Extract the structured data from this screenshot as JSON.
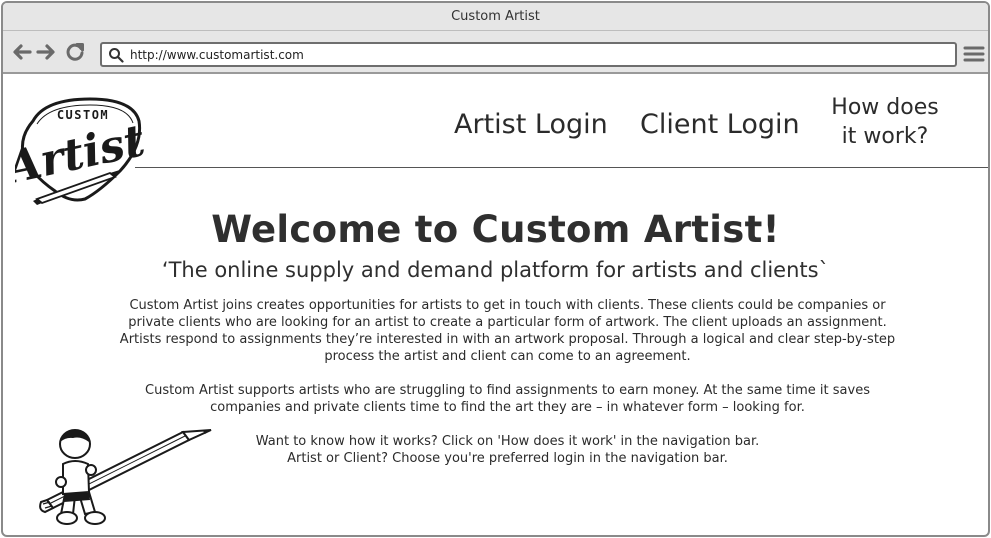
{
  "browser": {
    "window_title": "Custom Artist",
    "url": "http://www.customartist.com",
    "icons": {
      "back": "back-arrow-icon",
      "forward": "forward-arrow-icon",
      "reload": "reload-icon",
      "search": "search-icon",
      "menu": "hamburger-menu-icon"
    }
  },
  "logo": {
    "top_text": "CUSTOM",
    "script_text": "Artist"
  },
  "nav": {
    "artist_login": "Artist Login",
    "client_login": "Client Login",
    "how_line1": "How does",
    "how_line2": "it work?"
  },
  "hero": {
    "title": "Welcome to Custom Artist!",
    "subtitle": "‘The online supply and demand platform for artists and clients`"
  },
  "body": {
    "p1_l1": "Custom Artist joins creates opportunities for artists to get in touch with clients. These clients could be companies or",
    "p1_l2": "private clients who are looking for an artist to create a particular form of artwork. The client uploads an assignment.",
    "p1_l3": "Artists respond to assignments they’re interested in with an artwork proposal. Through a logical and clear step-by-step",
    "p1_l4": "process the artist and client can come to an agreement.",
    "p2_l1": "Custom Artist supports artists who are struggling to find assignments to earn money. At the same time it saves",
    "p2_l2": "companies and private clients time to find the art they are – in whatever form – looking for.",
    "p3_l1": "Want to know how it works? Click on 'How does it work' in the navigation bar.",
    "p3_l2": "Artist or Client? Choose you're preferred login in the navigation bar."
  },
  "colors": {
    "chrome": "#e6e6e6",
    "text": "#2b2b2b",
    "border": "#8a8a8a"
  }
}
